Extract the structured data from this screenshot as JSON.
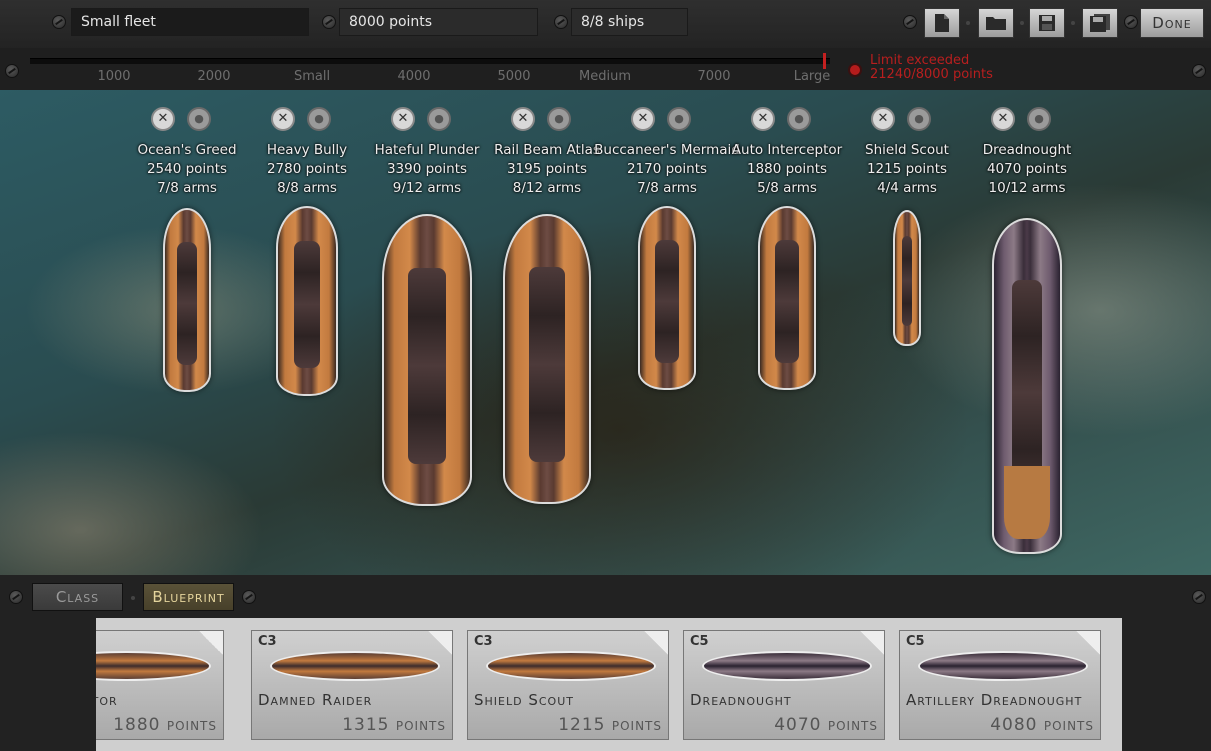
{
  "header": {
    "fleet_name": "Small fleet",
    "points": "8000 points",
    "ships": "8/8 ships",
    "done_label": "Done"
  },
  "slider": {
    "ticks": [
      "1000",
      "2000",
      "Small",
      "4000",
      "5000",
      "Medium",
      "7000",
      "Large"
    ],
    "limit_title": "Limit exceeded",
    "limit_value": "21240/8000 points"
  },
  "ships": [
    {
      "name": "Ocean's Greed",
      "points": "2540 points",
      "arms": "7/8 arms"
    },
    {
      "name": "Heavy Bully",
      "points": "2780 points",
      "arms": "8/8 arms"
    },
    {
      "name": "Hateful Plunder",
      "points": "3390 points",
      "arms": "9/12 arms"
    },
    {
      "name": "Rail Beam Atlas",
      "points": "3195 points",
      "arms": "8/12 arms"
    },
    {
      "name": "Buccaneer's Mermaid",
      "points": "2170 points",
      "arms": "7/8 arms"
    },
    {
      "name": "Auto Interceptor",
      "points": "1880 points",
      "arms": "5/8 arms"
    },
    {
      "name": "Shield Scout",
      "points": "1215 points",
      "arms": "4/4 arms"
    },
    {
      "name": "Dreadnought",
      "points": "4070 points",
      "arms": "10/12 arms"
    }
  ],
  "tabs": {
    "class": "Class",
    "blueprint": "Blueprint"
  },
  "blueprints": [
    {
      "class": "",
      "name": "Interceptor",
      "points": "1880 points"
    },
    {
      "class": "C3",
      "name": "Damned Raider",
      "points": "1315 points"
    },
    {
      "class": "C3",
      "name": "Shield Scout",
      "points": "1215 points"
    },
    {
      "class": "C5",
      "name": "Dreadnought",
      "points": "4070 points"
    },
    {
      "class": "C5",
      "name": "Artillery Dreadnought",
      "points": "4080 points"
    }
  ],
  "icons": {
    "remove": "close-icon",
    "captain": "person-icon",
    "new": "new-file-icon",
    "open": "folder-icon",
    "save": "save-icon",
    "save_as": "save-as-icon"
  },
  "colors": {
    "limit": "#b81f1f",
    "blueprint_tab": "#e4d49c"
  }
}
